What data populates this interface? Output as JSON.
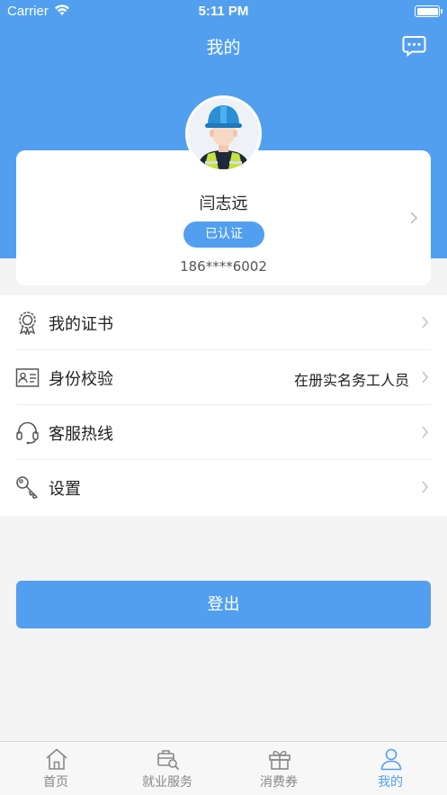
{
  "status_bar": {
    "carrier": "Carrier",
    "time": "5:11 PM"
  },
  "header": {
    "title": "我的"
  },
  "profile": {
    "name": "闫志远",
    "badge": "已认证",
    "phone": "186****6002"
  },
  "menu": {
    "items": [
      {
        "label": "我的证书",
        "value": "",
        "icon": "certificate-icon"
      },
      {
        "label": "身份校验",
        "value": "在册实名务工人员",
        "icon": "id-card-icon"
      },
      {
        "label": "客服热线",
        "value": "",
        "icon": "headset-icon"
      },
      {
        "label": "设置",
        "value": "",
        "icon": "key-icon"
      }
    ]
  },
  "logout_label": "登出",
  "tabbar": {
    "tabs": [
      {
        "label": "首页",
        "icon": "home-icon"
      },
      {
        "label": "就业服务",
        "icon": "job-search-icon"
      },
      {
        "label": "消费券",
        "icon": "gift-icon"
      },
      {
        "label": "我的",
        "icon": "user-icon"
      }
    ],
    "active_index": 3
  },
  "colors": {
    "primary": "#529ff0",
    "background": "#f4f4f4",
    "text": "#222222",
    "muted": "#888888"
  }
}
